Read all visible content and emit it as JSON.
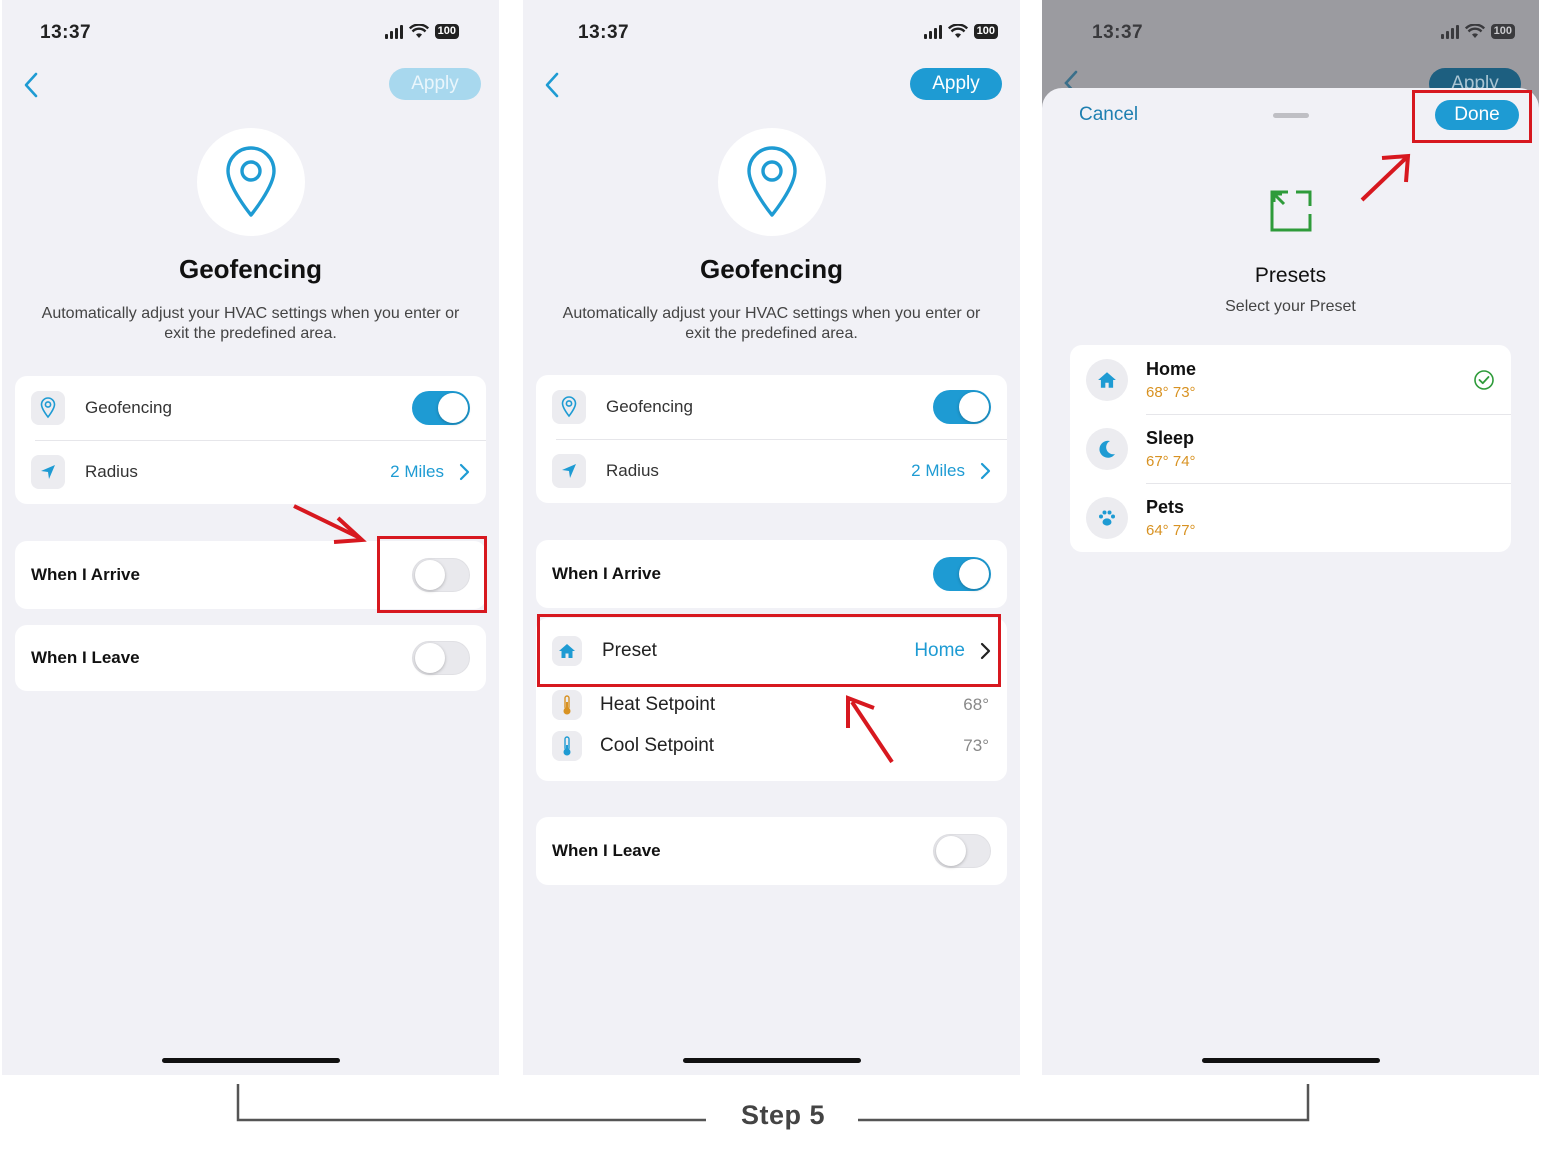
{
  "status_bar": {
    "time": "13:37",
    "battery": "100"
  },
  "screen1": {
    "apply_label": "Apply",
    "title": "Geofencing",
    "description": "Automatically adjust your HVAC settings when you enter or exit the predefined area.",
    "geofencing_label": "Geofencing",
    "radius_label": "Radius",
    "radius_value": "2 Miles",
    "arrive_label": "When I Arrive",
    "leave_label": "When I Leave",
    "geofencing_on": true,
    "arrive_on": false,
    "leave_on": false
  },
  "screen2": {
    "apply_label": "Apply",
    "title": "Geofencing",
    "description": "Automatically adjust your HVAC settings when you enter or exit the predefined area.",
    "geofencing_label": "Geofencing",
    "radius_label": "Radius",
    "radius_value": "2 Miles",
    "arrive_label": "When I Arrive",
    "preset_label": "Preset",
    "preset_value": "Home",
    "heat_label": "Heat Setpoint",
    "heat_value": "68°",
    "cool_label": "Cool Setpoint",
    "cool_value": "73°",
    "leave_label": "When I Leave",
    "geofencing_on": true,
    "arrive_on": true,
    "leave_on": false
  },
  "screen3": {
    "apply_label": "Apply",
    "cancel_label": "Cancel",
    "done_label": "Done",
    "title": "Presets",
    "subtitle": "Select your Preset",
    "presets": [
      {
        "name": "Home",
        "temps": "68° 73°",
        "icon": "home-icon",
        "selected": true
      },
      {
        "name": "Sleep",
        "temps": "67° 74°",
        "icon": "moon-icon",
        "selected": false
      },
      {
        "name": "Pets",
        "temps": "64° 77°",
        "icon": "paw-icon",
        "selected": false
      }
    ]
  },
  "caption": "Step 5",
  "colors": {
    "accent": "#1e9bd3",
    "annotation_red": "#d7181f",
    "temp_orange": "#d89222",
    "preset_green": "#2e9b3a"
  }
}
